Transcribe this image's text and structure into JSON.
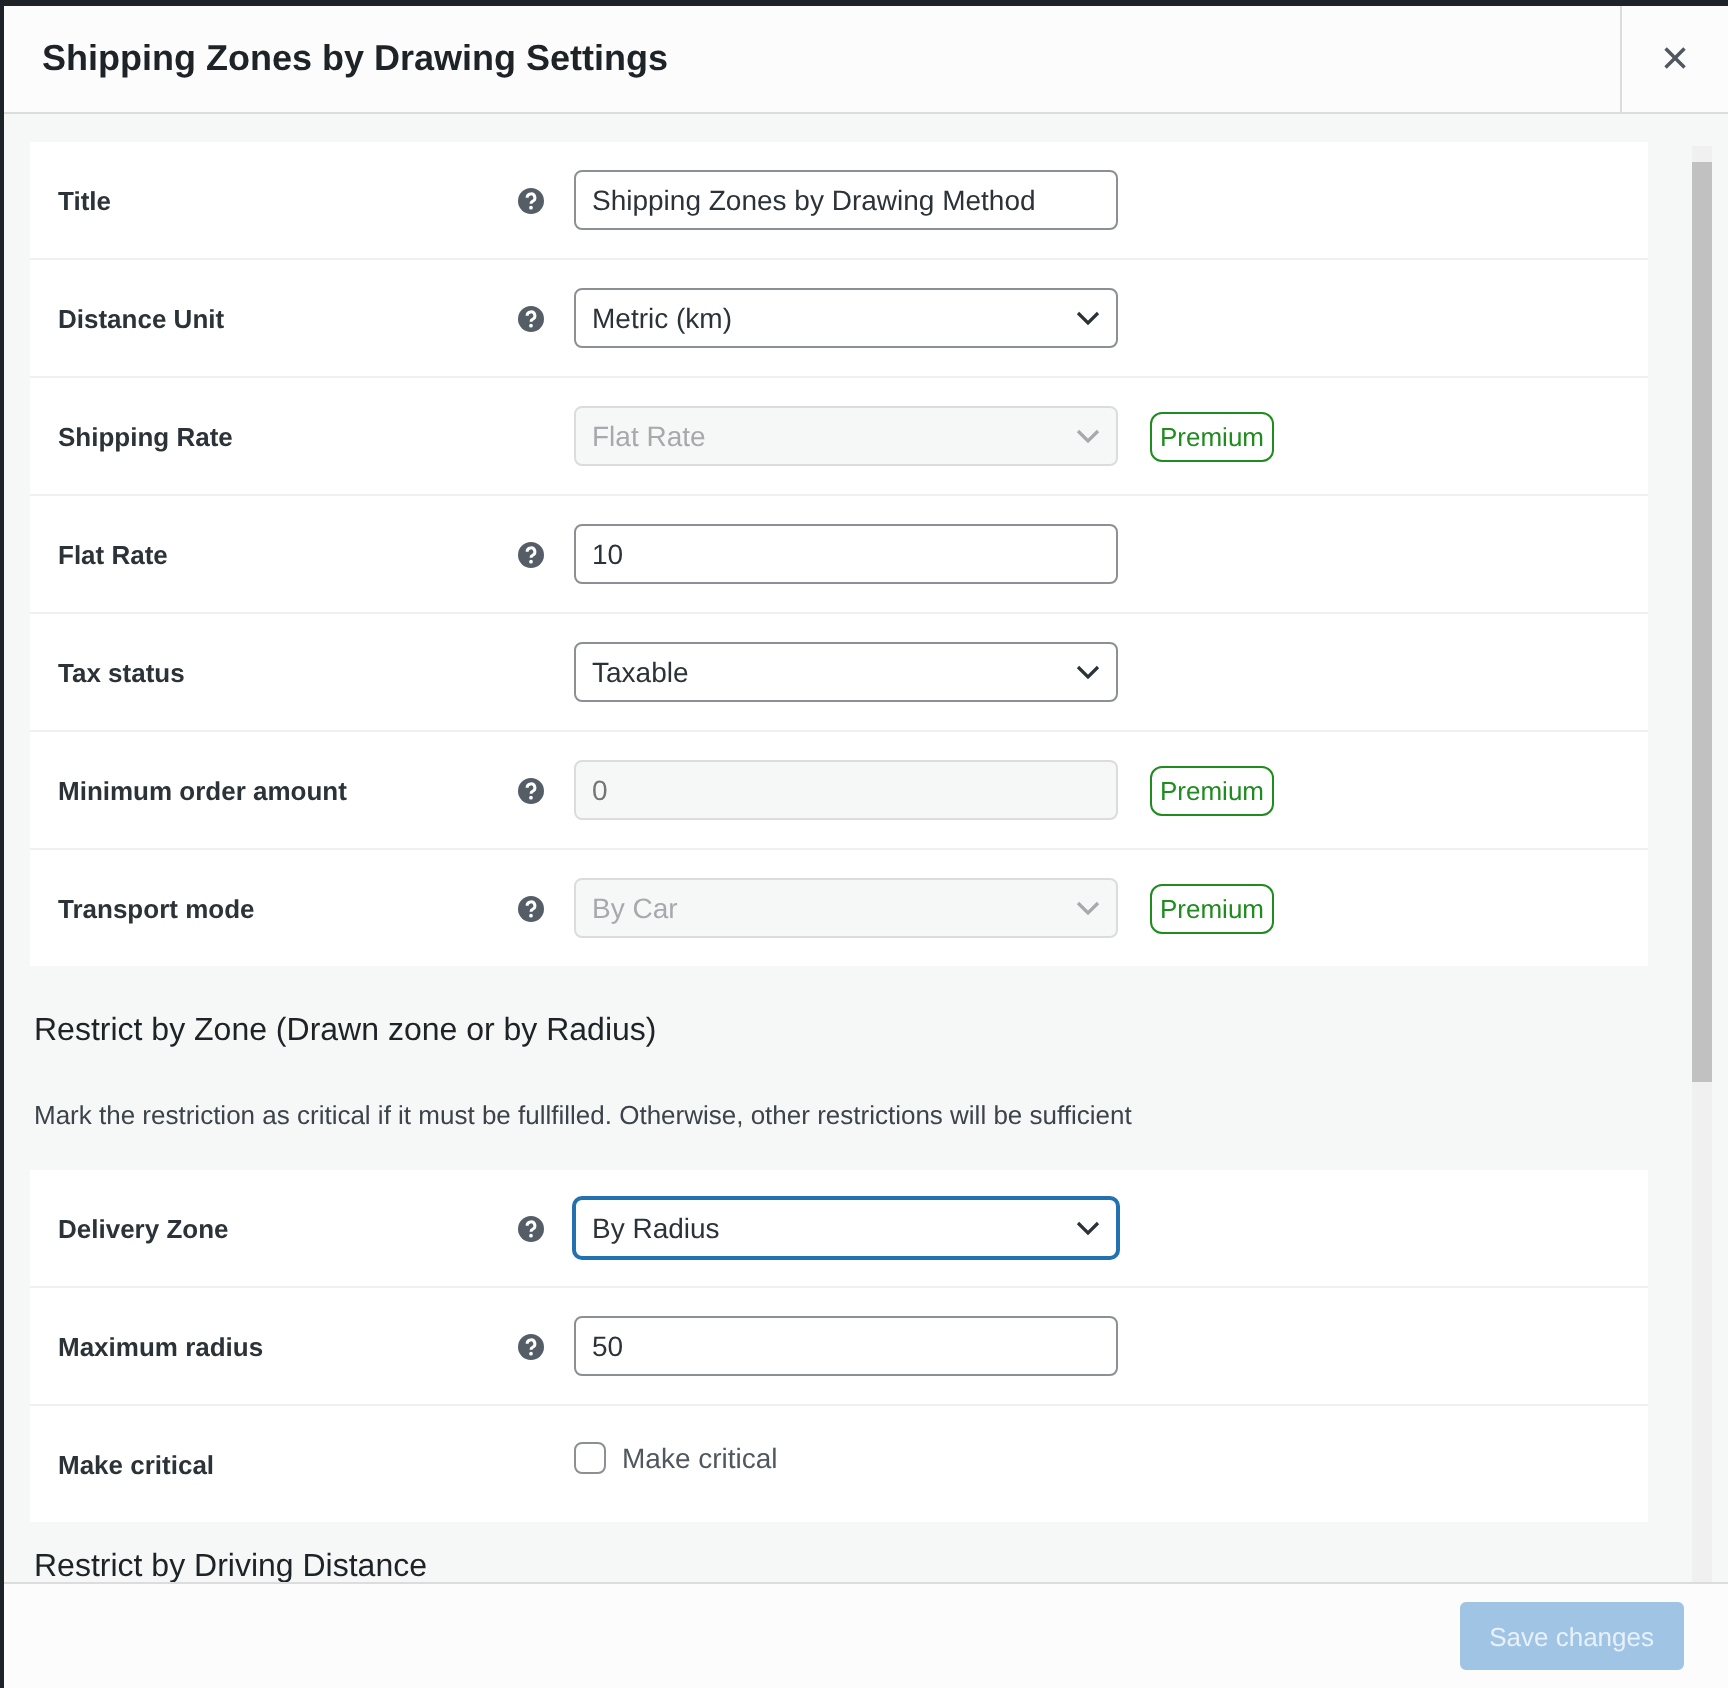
{
  "dialog": {
    "title": "Shipping Zones by Drawing Settings",
    "close": "×"
  },
  "sections": [
    {
      "rows": [
        {
          "label": "Title",
          "help": true,
          "kind": "text",
          "value": "Shipping Zones by Drawing Method",
          "disabled": false,
          "focused": false
        },
        {
          "label": "Distance Unit",
          "help": true,
          "kind": "select",
          "value": "Metric (km)",
          "disabled": false,
          "focused": false
        },
        {
          "label": "Shipping Rate",
          "help": false,
          "kind": "select",
          "value": "Flat Rate",
          "disabled": true,
          "focused": false,
          "badge": "Premium"
        },
        {
          "label": "Flat Rate",
          "help": true,
          "kind": "text",
          "value": "10",
          "disabled": false,
          "focused": false
        },
        {
          "label": "Tax status",
          "help": false,
          "kind": "select",
          "value": "Taxable",
          "disabled": false,
          "focused": false
        },
        {
          "label": "Minimum order amount",
          "help": true,
          "kind": "text",
          "placeholder": "0",
          "disabled": true,
          "focused": false,
          "badge": "Premium"
        },
        {
          "label": "Transport mode",
          "help": true,
          "kind": "select",
          "value": "By Car",
          "disabled": true,
          "focused": false,
          "badge": "Premium"
        }
      ]
    },
    {
      "heading": "Restrict by Zone (Drawn zone or by Radius)",
      "description": "Mark the restriction as critical if it must be fullfilled. Otherwise, other restrictions will be sufficient",
      "rows": [
        {
          "label": "Delivery Zone",
          "help": true,
          "kind": "select",
          "value": "By Radius",
          "disabled": false,
          "focused": true
        },
        {
          "label": "Maximum radius",
          "help": true,
          "kind": "text",
          "value": "50",
          "disabled": false,
          "focused": false
        },
        {
          "label": "Make critical",
          "help": false,
          "kind": "checkbox",
          "text": "Make critical",
          "checked": false
        }
      ]
    },
    {
      "heading": "Restrict by Driving Distance"
    }
  ],
  "footer": {
    "button": "Save changes",
    "disabled": true
  }
}
